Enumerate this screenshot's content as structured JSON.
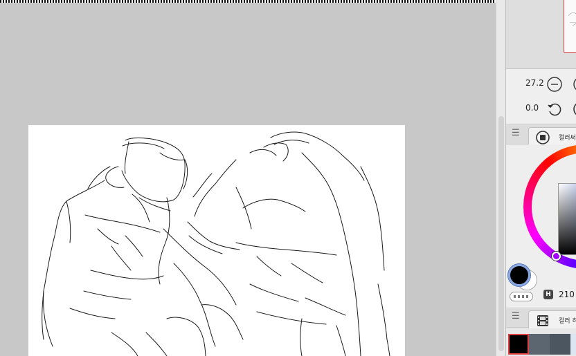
{
  "navigator": {
    "zoom_value": "27.2",
    "rotation_value": "0.0"
  },
  "color_panel": {
    "tab_label": "컬러써",
    "main_color": "#000000",
    "sub_color": "#ffffff",
    "hue_label": "H",
    "hue_value": "210"
  },
  "color_set_panel": {
    "tab_label": "컬러 히",
    "swatches": [
      "#000000",
      "#5b6670",
      "#4b5660",
      "#dbe6f2"
    ]
  },
  "colors": {
    "workspace_bg": "#c8c8c8",
    "panel_bg": "#e4e4e4",
    "accent_selection": "#e04040"
  }
}
